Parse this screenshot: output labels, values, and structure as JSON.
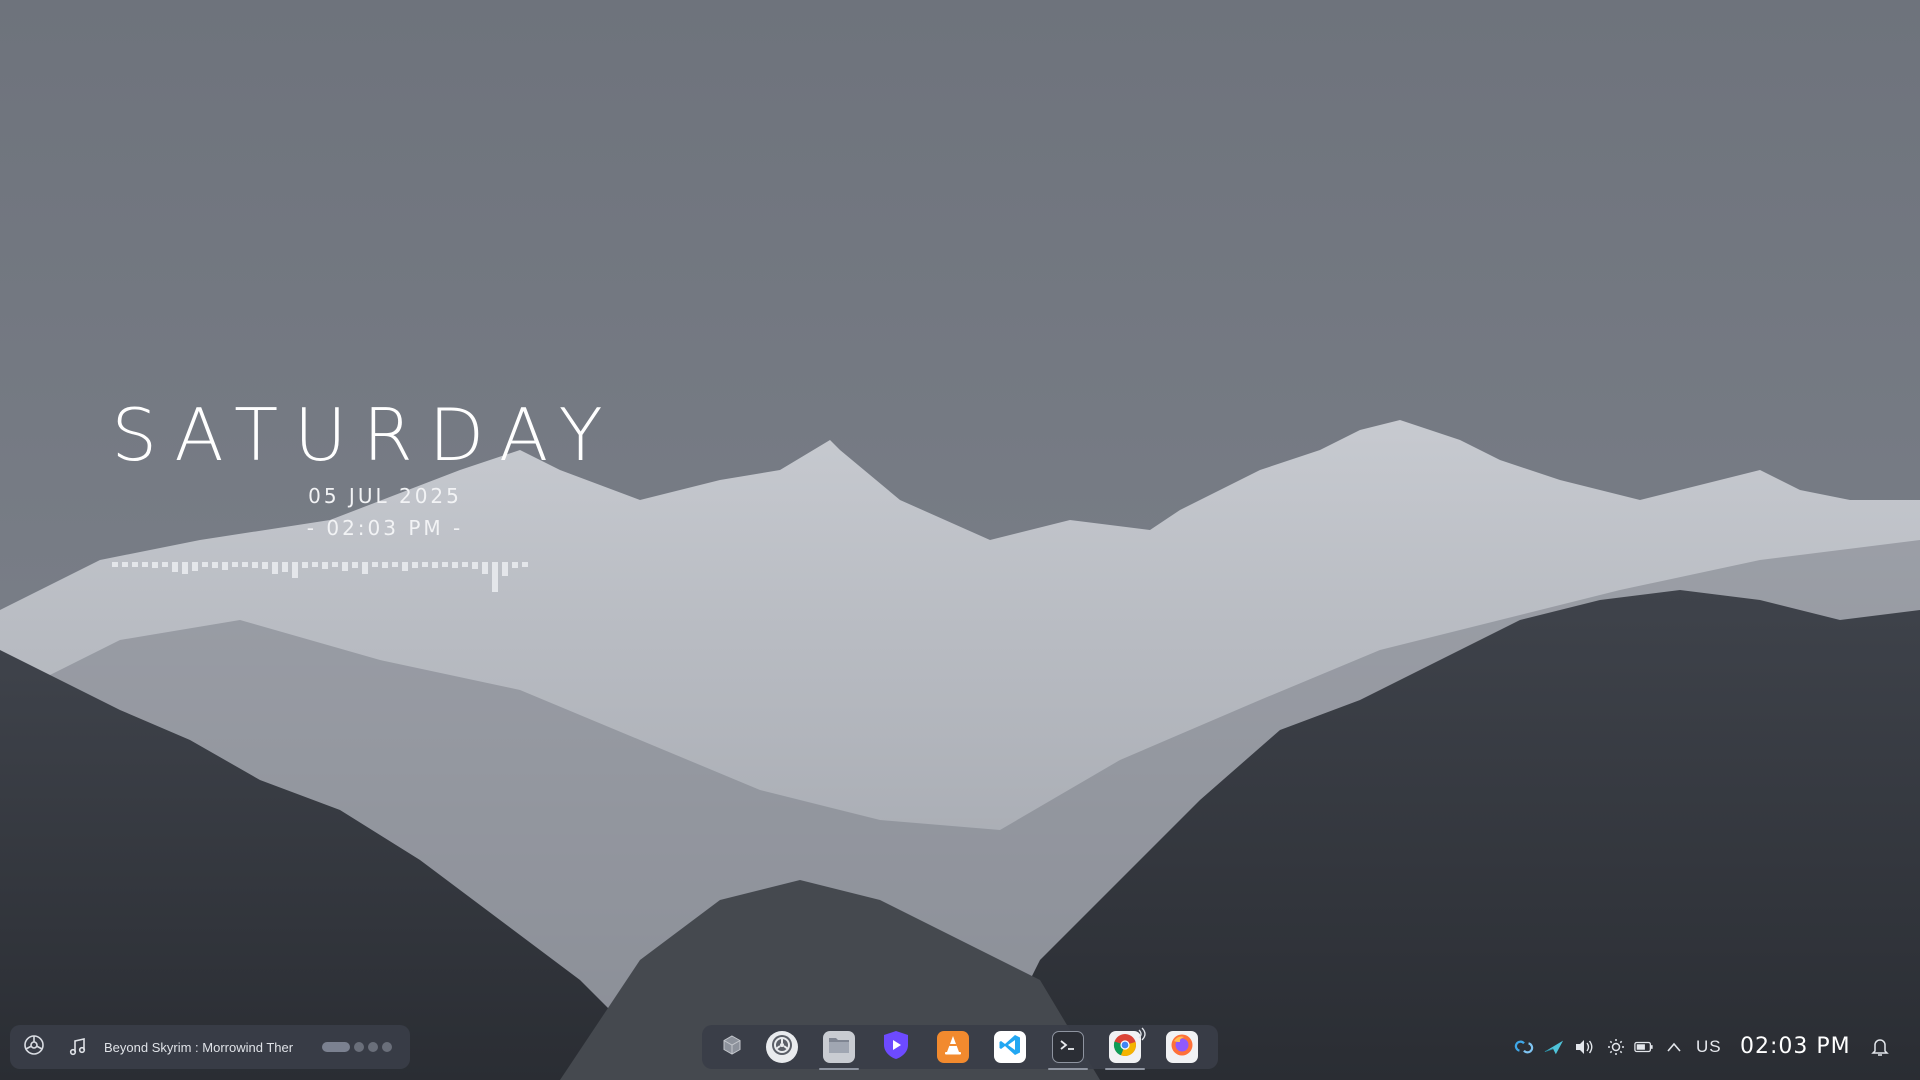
{
  "desktop": {
    "wallpaper": "snowy mountain range under overcast sky",
    "clock_widget": {
      "day": "SATURDAY",
      "date": "05 JUL 2025",
      "time": "- 02:03 PM -"
    }
  },
  "taskbar": {
    "left": {
      "launcher_icon": "application-launcher-icon",
      "music_icon": "music-note-icon",
      "now_playing": "Beyond Skyrim : Morrowind Ther"
    },
    "dock": {
      "apps": [
        {
          "name": "overview",
          "icon": "cube-icon"
        },
        {
          "name": "settings",
          "icon": "settings-wheel-icon"
        },
        {
          "name": "files",
          "icon": "folder-icon"
        },
        {
          "name": "protonvpn",
          "icon": "shield-play-icon"
        },
        {
          "name": "vlc",
          "icon": "traffic-cone-icon"
        },
        {
          "name": "vscode",
          "icon": "code-icon"
        },
        {
          "name": "terminal",
          "icon": "terminal-icon"
        },
        {
          "name": "chrome",
          "icon": "chrome-icon"
        },
        {
          "name": "firefox",
          "icon": "firefox-icon"
        }
      ]
    },
    "tray": {
      "keyboard_layout": "US",
      "time": "02:03 PM",
      "icons": [
        "sync-icon",
        "paper-plane-icon",
        "volume-icon",
        "brightness-icon",
        "battery-icon",
        "chevron-up-icon",
        "bell-icon"
      ]
    }
  },
  "colors": {
    "panel": "#3a3e48",
    "text": "#ffffff",
    "proton": "#6d4aff",
    "vlc": "#f28a2e",
    "vscode": "#23a7f2"
  }
}
